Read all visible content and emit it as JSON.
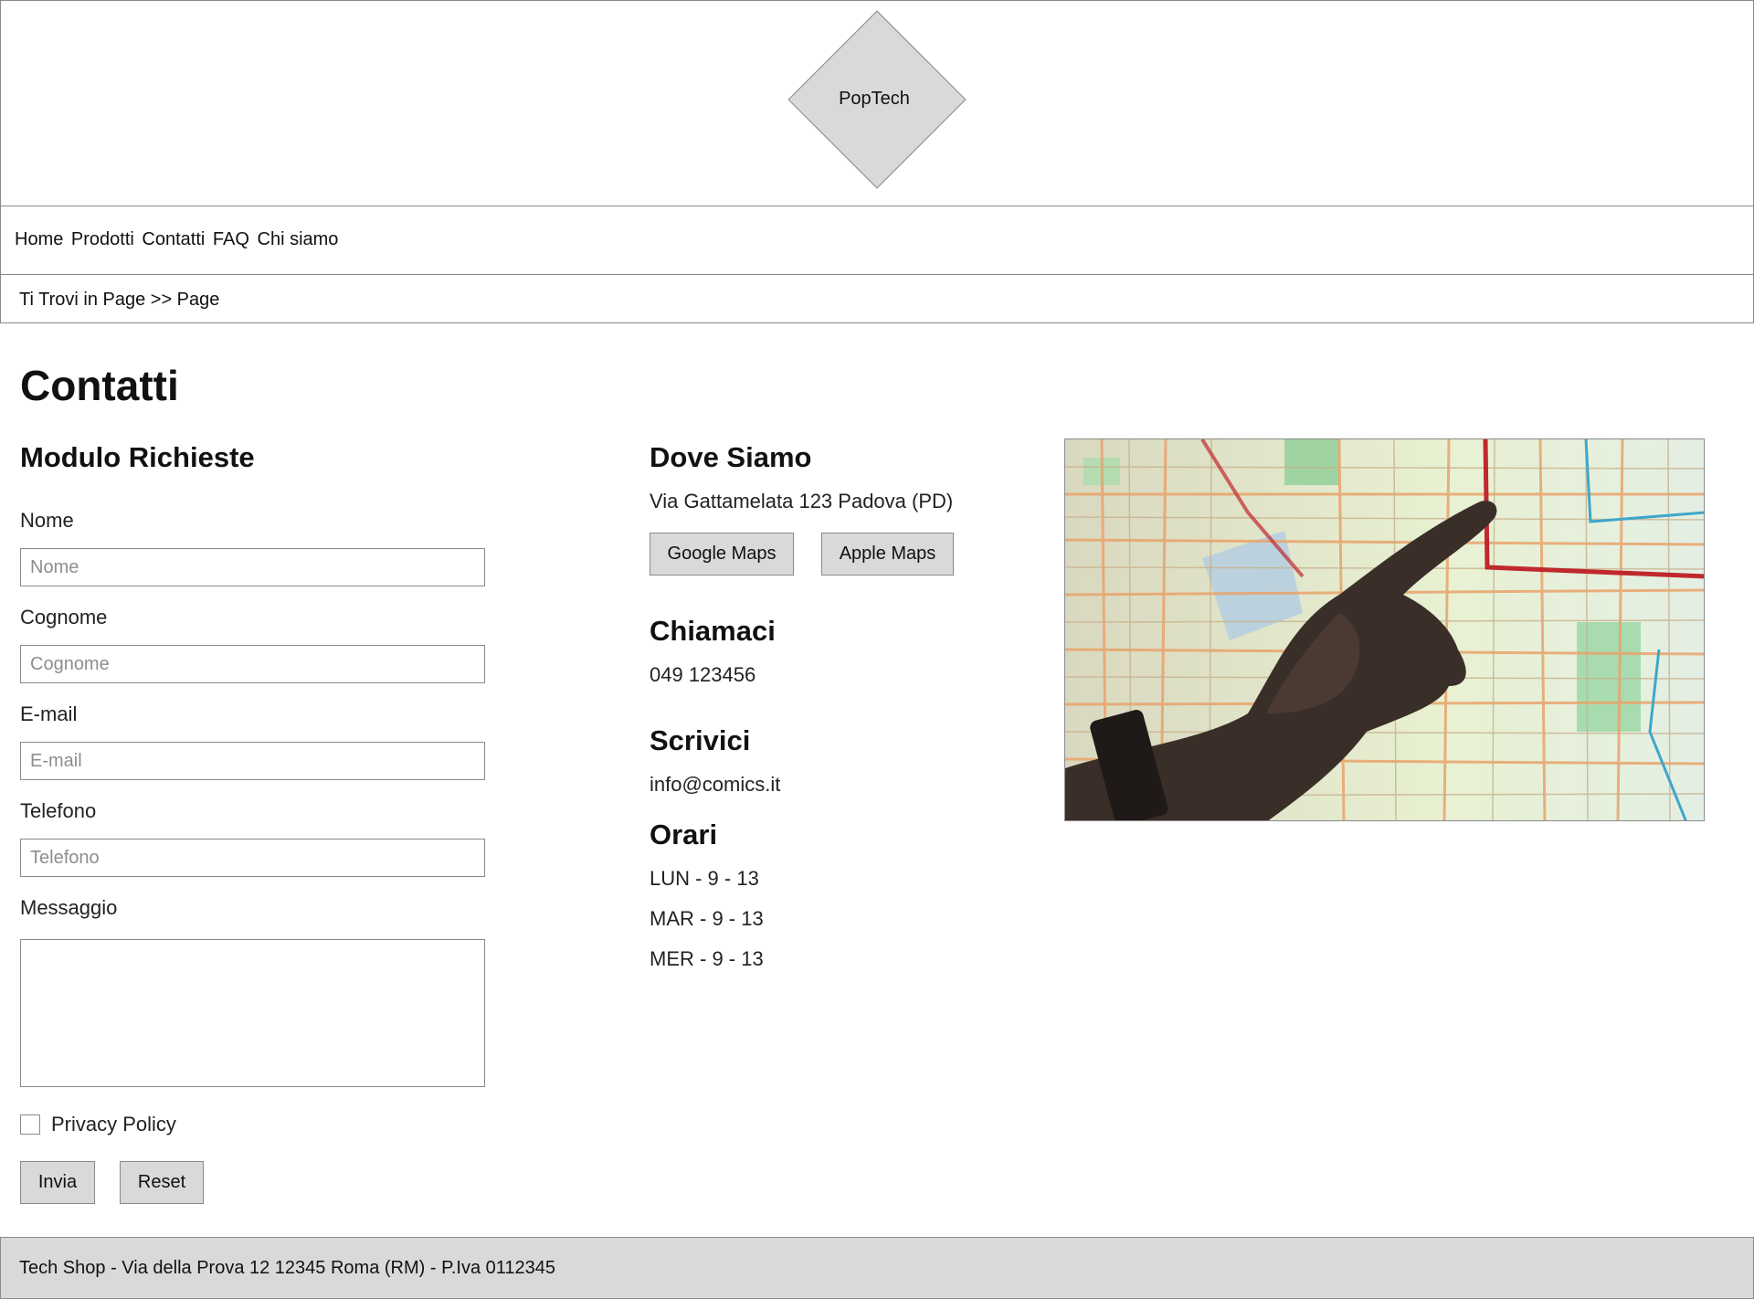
{
  "header": {
    "logo_text": "PopTech"
  },
  "nav": {
    "items": [
      "Home",
      "Prodotti",
      "Contatti",
      "FAQ",
      "Chi siamo"
    ]
  },
  "breadcrumb": {
    "text": "Ti Trovi in Page >> Page"
  },
  "page": {
    "title": "Contatti"
  },
  "form": {
    "heading": "Modulo Richieste",
    "fields": [
      {
        "label": "Nome",
        "placeholder": "Nome",
        "value": ""
      },
      {
        "label": "Cognome",
        "placeholder": "Cognome",
        "value": ""
      },
      {
        "label": "E-mail",
        "placeholder": "E-mail",
        "value": ""
      },
      {
        "label": "Telefono",
        "placeholder": "Telefono",
        "value": ""
      }
    ],
    "message_label": "Messaggio",
    "message_value": "",
    "privacy_label": "Privacy Policy",
    "privacy_checked": false,
    "submit_label": "Invia",
    "reset_label": "Reset"
  },
  "location": {
    "heading": "Dove Siamo",
    "address": "Via Gattamelata 123 Padova (PD)",
    "google_maps_label": "Google Maps",
    "apple_maps_label": "Apple Maps"
  },
  "call": {
    "heading": "Chiamaci",
    "phone": "049 123456"
  },
  "write": {
    "heading": "Scrivici",
    "email": "info@comics.it"
  },
  "hours": {
    "heading": "Orari",
    "lines": [
      "LUN - 9 - 13",
      "MAR - 9 - 13",
      "MER - 9 - 13"
    ]
  },
  "image": {
    "subject": "hand-pointing-at-transit-map"
  },
  "footer": {
    "text": "Tech Shop - Via della Prova 12 12345 Roma (RM) - P.Iva 0112345"
  },
  "colors": {
    "border": "#8a8a8a",
    "button_bg": "#d9d9d9",
    "footer_bg": "#d9d9d9",
    "placeholder": "#8e8e8e"
  }
}
